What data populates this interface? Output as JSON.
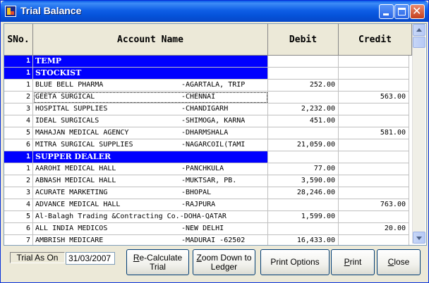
{
  "window": {
    "title": "Trial Balance"
  },
  "columns": {
    "sno": "SNo.",
    "account": "Account Name",
    "debit": "Debit",
    "credit": "Credit"
  },
  "rows": [
    {
      "sno": "1",
      "name": "TEMP",
      "city": "",
      "debit": "",
      "credit": "",
      "group": true
    },
    {
      "sno": "1",
      "name": "STOCKIST",
      "city": "",
      "debit": "",
      "credit": "",
      "group": true
    },
    {
      "sno": "1",
      "name": "BLUE BELL PHARMA",
      "city": "-AGARTALA, TRIP",
      "debit": "252.00",
      "credit": ""
    },
    {
      "sno": "2",
      "name": "GEETA SURGICAL",
      "city": "-CHENNAI",
      "debit": "",
      "credit": "563.00",
      "selected": true
    },
    {
      "sno": "3",
      "name": "HOSPITAL SUPPLIES",
      "city": "-CHANDIGARH",
      "debit": "2,232.00",
      "credit": ""
    },
    {
      "sno": "4",
      "name": "IDEAL SURGICALS",
      "city": "-SHIMOGA, KARNA",
      "debit": "451.00",
      "credit": ""
    },
    {
      "sno": "5",
      "name": "MAHAJAN MEDICAL AGENCY",
      "city": "-DHARMSHALA",
      "debit": "",
      "credit": "581.00"
    },
    {
      "sno": "6",
      "name": "MITRA SURGICAL SUPPLIES",
      "city": "-NAGARCOIL(TAMI",
      "debit": "21,059.00",
      "credit": ""
    },
    {
      "sno": "1",
      "name": "SUPPER DEALER",
      "city": "",
      "debit": "",
      "credit": "",
      "group": true
    },
    {
      "sno": "1",
      "name": "AAROHI MEDICAL HALL",
      "city": "-PANCHKULA",
      "debit": "77.00",
      "credit": ""
    },
    {
      "sno": "2",
      "name": "ABNASH MEDICAL HALL",
      "city": "-MUKTSAR, PB.",
      "debit": "3,590.00",
      "credit": ""
    },
    {
      "sno": "3",
      "name": "ACURATE MARKETING",
      "city": "-BHOPAL",
      "debit": "28,246.00",
      "credit": ""
    },
    {
      "sno": "4",
      "name": "ADVANCE MEDICAL HALL",
      "city": "-RAJPURA",
      "debit": "",
      "credit": "763.00"
    },
    {
      "sno": "5",
      "name": "Al-Balagh Trading &Contracting Co.-DOHA-QATAR",
      "city": "",
      "debit": "1,599.00",
      "credit": ""
    },
    {
      "sno": "6",
      "name": "ALL INDIA MEDICOS",
      "city": "-NEW DELHI",
      "debit": "",
      "credit": "20.00"
    },
    {
      "sno": "7",
      "name": "AMBRISH MEDICARE",
      "city": "-MADURAI -62502",
      "debit": "16,433.00",
      "credit": ""
    }
  ],
  "footer": {
    "trial_label": "Trial As On",
    "trial_date": "31/03/2007",
    "recalc_ul": "R",
    "recalc_rest": "e-Calculate",
    "recalc_line2": "Trial",
    "zoom_ul": "Z",
    "zoom_rest": "oom Down to",
    "zoom_line2": "Ledger",
    "print_options": "Print Options",
    "print_ul": "P",
    "print_rest": "rint",
    "close_ul": "C",
    "close_rest": "lose"
  }
}
